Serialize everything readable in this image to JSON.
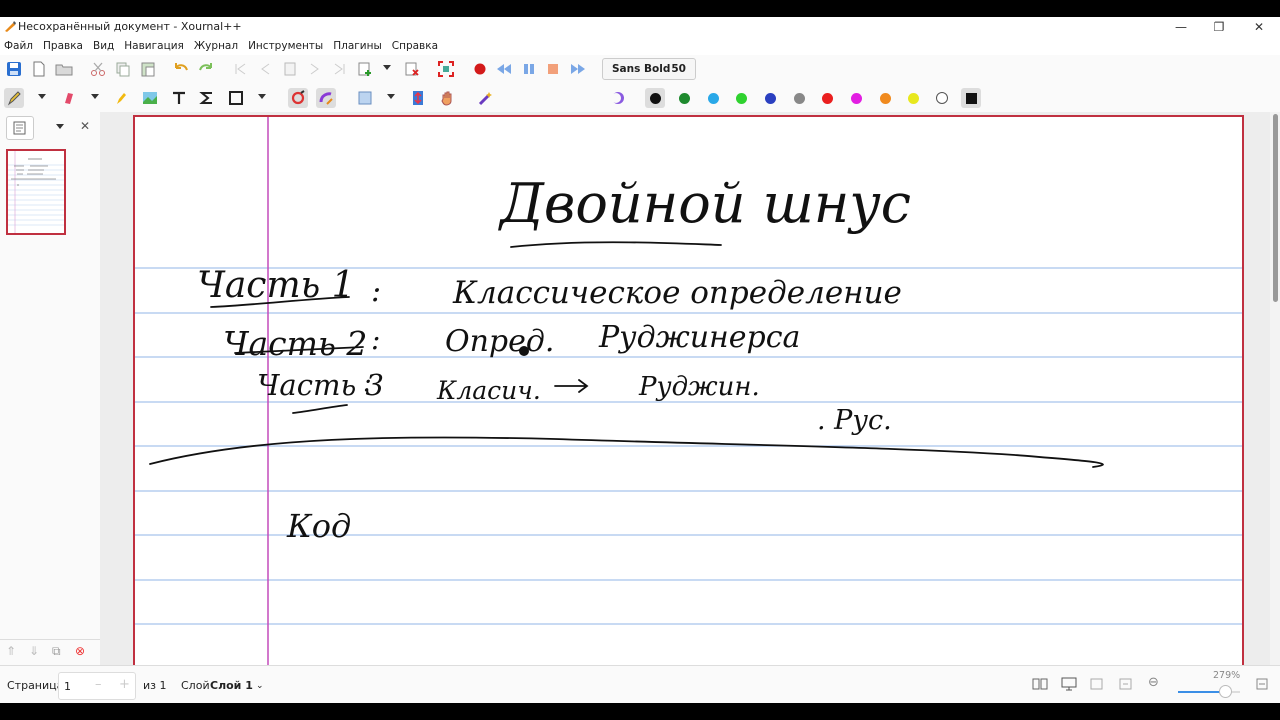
{
  "window": {
    "title": "Несохранённый документ - Xournal++"
  },
  "menu": [
    "Файл",
    "Правка",
    "Вид",
    "Навигация",
    "Журнал",
    "Инструменты",
    "Плагины",
    "Справка"
  ],
  "toolbar": {
    "font_name": "Sans Bold",
    "font_size": "50"
  },
  "colors": {
    "accent": "#c03040",
    "rule_line": "#a8c4ec",
    "margin_line": "#c44bbb",
    "ink": "#111111"
  },
  "palette": [
    "#111111",
    "#1e8a2e",
    "#29a8e8",
    "#2fd22f",
    "#2a3fc0",
    "#888888",
    "#ea1f1f",
    "#e21ee2",
    "#f08a1e",
    "#e8e81e",
    "#ffffff",
    "#111111"
  ],
  "status": {
    "page_label": "Страница",
    "page_value": "1",
    "page_total": "из 1",
    "layer_label": "Слой",
    "layer_value": "Слой 1",
    "zoom": "279%"
  },
  "page_content": {
    "title": "Двойной шнус",
    "lines": [
      {
        "part": "Часть 1",
        "sep": ":",
        "text": "Классическое определение"
      },
      {
        "part": "Часть 2",
        "sep": ":",
        "text": "Опред.",
        "extra": "Руджинерса"
      },
      {
        "part": "Часть 3",
        "sep": ":",
        "text": "Класич.",
        "arrow": "→",
        "extra": "Руджин."
      },
      {
        "text": ". Рус."
      },
      {
        "text": "Код"
      }
    ]
  }
}
